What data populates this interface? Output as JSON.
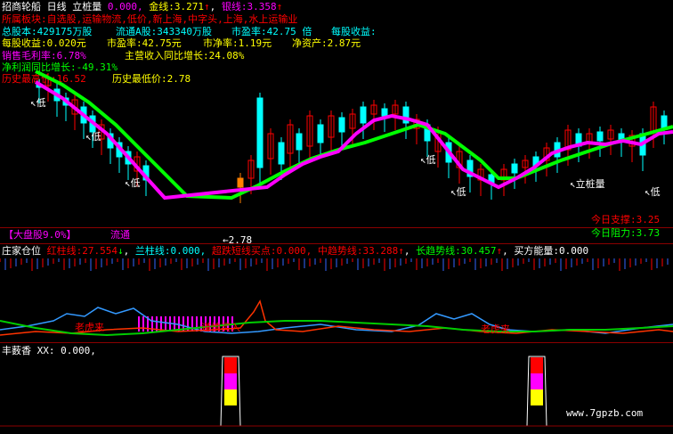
{
  "header": {
    "stock_name": "招商轮船",
    "period": "日线",
    "indicator_name": "立桩量",
    "items": [
      {
        "label": "",
        "value": "0.000,",
        "color": "#ff00ff"
      },
      {
        "label": "金线:",
        "value": "3.271",
        "arrow": "↑",
        "color": "#ffff00"
      },
      {
        "label": "银线:",
        "value": "3.358",
        "arrow": "↑",
        "color": "#ff00ff"
      }
    ]
  },
  "info": {
    "sector_line": "所属板块:自选股,运输物流,低价,新上海,中字头,上海,水上运输业",
    "total_shares": "总股本:429175万股",
    "float_a": "流通A股:343340万股",
    "pe": "市盈率:42.75 倍",
    "eps_label": "每股收益:",
    "eps2": "每股收益:0.020元",
    "pe2": "市盈率:42.75元",
    "pb": "市净率:1.19元",
    "nav": "净资产:2.87元",
    "gross_margin": "销售毛利率:6.78%",
    "revenue_growth": "主营收入同比增长:24.08%",
    "profit_growth": "净利润同比增长:-49.31%",
    "hist_high": "历史最高价:16.52",
    "hist_low": "历史最低价:2.78"
  },
  "chart_labels": {
    "low": "低",
    "lizhuang": "立桩量",
    "support_label": "今日支撑:",
    "support_value": "3.25",
    "resist_label": "今日阻力:",
    "resist_value": "3.73",
    "low_price": "2.78"
  },
  "panel2": {
    "dapan": "【大盘股9.0%】",
    "liutong": "流通",
    "title": "庄家仓位",
    "items": [
      {
        "label": "红柱线:",
        "value": "27.554",
        "arrow": "↓"
      },
      {
        "label": "兰柱线:",
        "value": "0.000,"
      },
      {
        "label": "超跌短线买点:",
        "value": "0.000,"
      },
      {
        "label": "中趋势线:",
        "value": "33.288",
        "arrow": "↑"
      },
      {
        "label": "长趋势线:",
        "value": "30.457",
        "arrow": "↑"
      },
      {
        "label": "买方能量:",
        "value": "0.000"
      }
    ],
    "annotation_tiger": "老虎来",
    "annotation_buy": "谨慎买入"
  },
  "panel3": {
    "title": "丰薮香",
    "xx_label": "XX:",
    "xx_value": "0.000,"
  },
  "watermark": "www.7gpzb.com",
  "colors": {
    "red": "#ff0000",
    "yellow": "#ffff00",
    "magenta": "#ff00ff",
    "green": "#00ff00",
    "cyan": "#00ffff",
    "white": "#ffffff",
    "orange": "#ff8000",
    "grid": "#8b0000"
  }
}
